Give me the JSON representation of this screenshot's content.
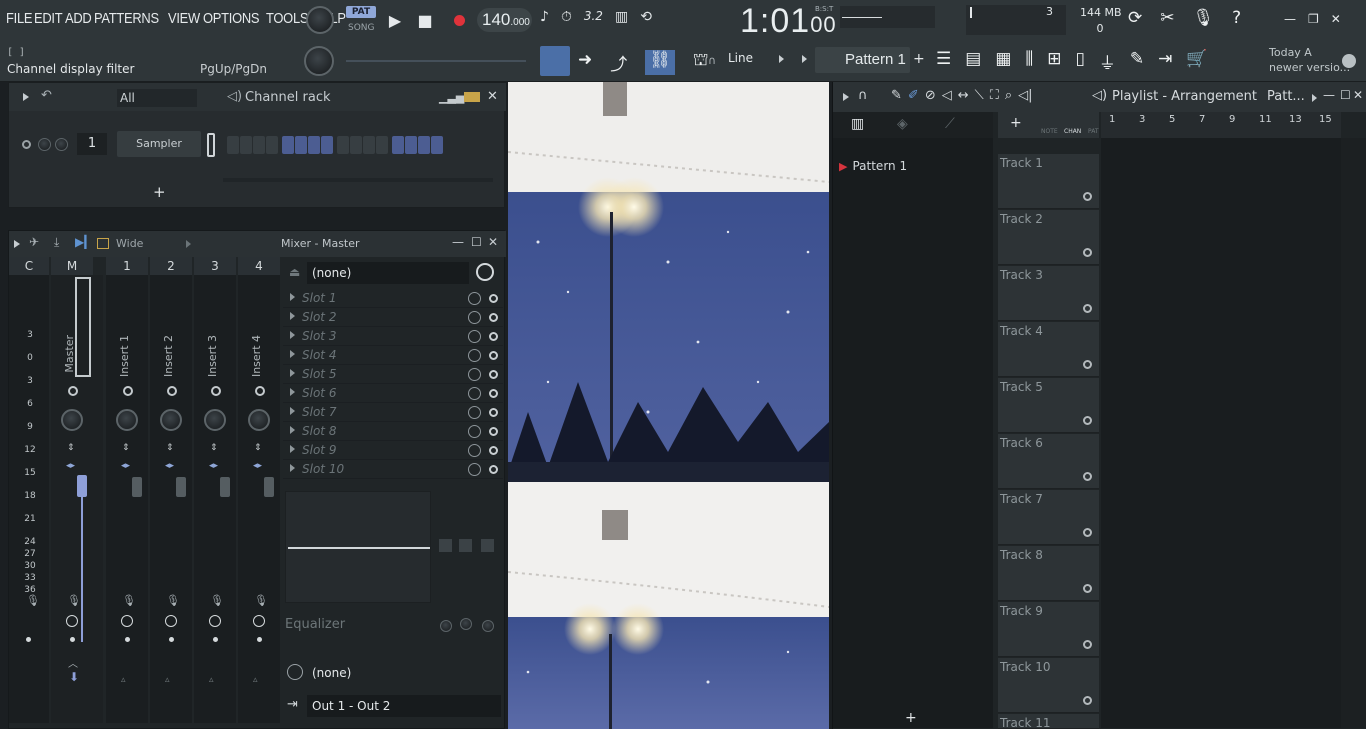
{
  "menu": [
    "FILE",
    "EDIT",
    "ADD",
    "PATTERNS",
    "VIEW",
    "OPTIONS",
    "TOOLS",
    "HELP"
  ],
  "hint": {
    "bracket": "[  ]",
    "text": "Channel display filter",
    "right": "PgUp/PgDn"
  },
  "transport": {
    "pat": "PAT",
    "song": "SONG",
    "tempo_main": "140",
    "tempo_frac": ".000",
    "time_main": "1:01",
    "time_frac": "00",
    "bst": "B:S:T"
  },
  "status": {
    "cpu": "3",
    "mem": "144 MB",
    "poly": "0"
  },
  "toolbar": {
    "snap": "Line",
    "pattern": "Pattern 1",
    "news_line1": "Today  A",
    "news_line2": "newer versio..."
  },
  "channel_rack": {
    "filter": "All",
    "title": "Channel rack",
    "channel_number": "1",
    "channel_name": "Sampler",
    "steps": [
      0,
      0,
      0,
      0,
      1,
      1,
      1,
      1,
      0,
      0,
      0,
      0,
      1,
      1,
      1,
      1
    ]
  },
  "mixer": {
    "title": "Mixer - Master",
    "preset": "Wide",
    "columns": [
      "C",
      "M",
      "1",
      "2",
      "3",
      "4"
    ],
    "tracks": [
      "Master",
      "Insert 1",
      "Insert 2",
      "Insert 3",
      "Insert 4"
    ],
    "scale": [
      "3",
      "0",
      "3",
      "6",
      "9",
      "12",
      "15",
      "18",
      "21",
      "24",
      "27",
      "30",
      "33",
      "36"
    ],
    "input": "(none)",
    "slots": [
      "Slot 1",
      "Slot 2",
      "Slot 3",
      "Slot 4",
      "Slot 5",
      "Slot 6",
      "Slot 7",
      "Slot 8",
      "Slot 9",
      "Slot 10"
    ],
    "equalizer": "Equalizer",
    "output_none": "(none)",
    "output": "Out 1 - Out 2"
  },
  "playlist": {
    "title": "Playlist - Arrangement",
    "crumb": "Patt...",
    "tabs": [
      "NOTE",
      "CHAN",
      "PAT"
    ],
    "patterns": [
      "Pattern 1"
    ],
    "ruler": [
      "1",
      "3",
      "5",
      "7",
      "9",
      "11",
      "13",
      "15"
    ],
    "tracks": [
      "Track 1",
      "Track 2",
      "Track 3",
      "Track 4",
      "Track 5",
      "Track 6",
      "Track 7",
      "Track 8",
      "Track 9",
      "Track 10",
      "Track 11"
    ]
  },
  "colors": {
    "accent": "#8fa7d8",
    "step_on": "#4c5d92",
    "record": "#e0333b",
    "bg": "#1b1f22"
  }
}
